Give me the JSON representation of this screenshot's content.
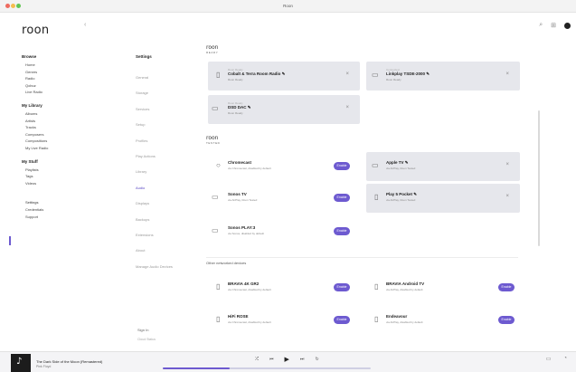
{
  "window": {
    "title": "Roon"
  },
  "header": {
    "logo": "roon",
    "back_icon": "chevron-left-icon",
    "icons": [
      "search-icon",
      "grid-icon"
    ]
  },
  "sidebar": {
    "sections": [
      {
        "heading": "Browse",
        "items": [
          "Home",
          "Genres",
          "Radio",
          "Qobuz",
          "Live Radio"
        ]
      },
      {
        "heading": "My Library",
        "items": [
          "Albums",
          "Artists",
          "Tracks",
          "Composers",
          "Compositions",
          "My Live Radio"
        ]
      },
      {
        "heading": "My Stuff",
        "items": [
          "Playlists",
          "Tags",
          "Videos"
        ]
      }
    ],
    "bottom_items": [
      "Settings",
      "Credentials",
      "Support"
    ]
  },
  "settings": {
    "heading": "Settings",
    "items": [
      "General",
      "Storage",
      "Services",
      "Setup",
      "Profiles",
      "Play Actions",
      "Library",
      "Audio",
      "Displays",
      "Backups",
      "Extensions",
      "About",
      "Manage Audio Devices"
    ],
    "active_index": 7,
    "footer": "Sign In",
    "footer_sub": "Cloud Status"
  },
  "roon_ready": {
    "brand": "roon",
    "brand_sub": "READY",
    "devices": [
      {
        "eyebrow": "Roon Ready",
        "name": "Cobalt & Terra Room Radio",
        "sub": "Roon Ready",
        "icon": "speaker-icon"
      },
      {
        "eyebrow": "Connected",
        "name": "Linkplay TSDE-2000",
        "sub": "Roon Ready",
        "icon": "streamer-icon"
      },
      {
        "eyebrow": "Roon Ready",
        "name": "DSD DAC",
        "sub": "Roon Ready",
        "icon": "dac-icon"
      }
    ]
  },
  "roon_tested": {
    "brand": "roon",
    "brand_sub": "TESTED",
    "devices": [
      {
        "name": "Chromecast",
        "sub": "via Chromecast, disabled by default",
        "action": "Enable",
        "icon": "chromecast-icon"
      },
      {
        "name": "Apple TV",
        "sub": "via AirPlay, Roon Tested",
        "action": "",
        "icon": "appletv-icon"
      },
      {
        "name": "Sonos TV",
        "sub": "via AirPlay, Roon Tested",
        "action": "Enable",
        "icon": "tv-icon"
      },
      {
        "name": "Play 5 Pocket",
        "sub": "via AirPlay, Roon Tested",
        "action": "",
        "icon": "phone-icon"
      },
      {
        "name": "Sonos PLAY:3",
        "sub": "via Sonos, disabled by default",
        "action": "Enable",
        "icon": "speaker-icon"
      }
    ]
  },
  "other_devices": {
    "heading": "Other networked devices",
    "devices": [
      {
        "name": "BRAVIA 4K GR2",
        "sub": "via Chromecast, disabled by default",
        "action": "Enable",
        "icon": "speaker-icon"
      },
      {
        "name": "BRAVIA Android TV",
        "sub": "via AirPlay, disabled by default",
        "action": "Enable",
        "icon": "speaker-icon"
      },
      {
        "name": "HiFi ROSE",
        "sub": "via Chromecast, disabled by default",
        "action": "Enable",
        "icon": "speaker-icon"
      },
      {
        "name": "Endeavour",
        "sub": "via AirPlay, disabled by default",
        "action": "Enable",
        "icon": "speaker-icon"
      }
    ]
  },
  "now_playing": {
    "title": "The Dark Side of the Moon (Remastered)",
    "artist": "Pink Floyd",
    "progress": 0.32,
    "controls": [
      "shuffle-icon",
      "previous-icon",
      "play-icon",
      "next-icon",
      "repeat-icon"
    ],
    "right_icons": [
      "zone-icon",
      "volume-icon"
    ]
  },
  "colors": {
    "accent": "#6d5ad0",
    "card_gray": "#e6e7ec"
  }
}
